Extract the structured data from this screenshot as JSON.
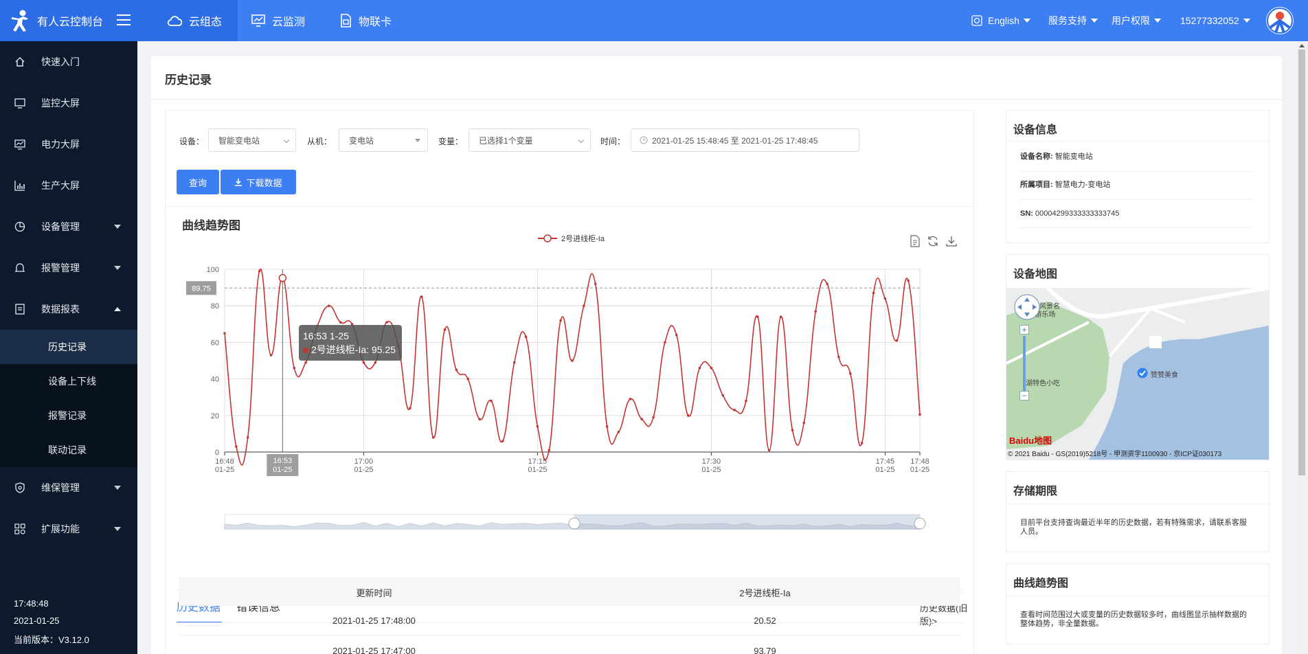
{
  "header": {
    "brand": "有人云控制台",
    "nav": [
      {
        "label": "云组态",
        "icon": "cloud-icon",
        "active": true
      },
      {
        "label": "云监测",
        "icon": "monitor-icon",
        "active": false
      },
      {
        "label": "物联卡",
        "icon": "sim-card-icon",
        "active": false
      }
    ],
    "language": "English",
    "service": "服务支持",
    "permissions": "用户权限",
    "account": "15277332052"
  },
  "sidebar": {
    "items": [
      {
        "label": "快速入门",
        "icon": "home-icon"
      },
      {
        "label": "监控大屏",
        "icon": "screen-icon"
      },
      {
        "label": "电力大屏",
        "icon": "power-screen-icon"
      },
      {
        "label": "生产大屏",
        "icon": "bar-chart-icon"
      },
      {
        "label": "设备管理",
        "icon": "device-icon"
      },
      {
        "label": "报警管理",
        "icon": "bell-icon"
      },
      {
        "label": "数据报表",
        "icon": "report-icon"
      }
    ],
    "sub_items": [
      {
        "label": "历史记录",
        "active": true
      },
      {
        "label": "设备上下线",
        "active": false
      },
      {
        "label": "报警记录",
        "active": false
      },
      {
        "label": "联动记录",
        "active": false
      }
    ],
    "bottom_items": [
      {
        "label": "维保管理",
        "icon": "shield-icon"
      },
      {
        "label": "扩展功能",
        "icon": "apps-icon"
      }
    ],
    "time": "17:48:48",
    "date": "2021-01-25",
    "version": "当前版本：V3.12.0"
  },
  "page": {
    "title": "历史记录"
  },
  "filters": {
    "device_label": "设备：",
    "device_value": "智能变电站",
    "slave_label": "从机：",
    "slave_value": "变电站",
    "variable_label": "变量：",
    "variable_value": "已选择1个变量",
    "time_label": "时间：",
    "time_value": "2021-01-25 15:48:45 至 2021-01-25 17:48:45",
    "query_button": "查询",
    "download_button": "下载数据"
  },
  "chart": {
    "title": "曲线趋势图",
    "legend": "2号进线柜-Ia",
    "markline_value": "89.75",
    "tooltip_title": "16:53 1-25",
    "tooltip_text": "2号进线柜-Ia: 95.25",
    "axis_pointer_label": "16:53",
    "axis_pointer_date": "01-25",
    "color": "#c23531"
  },
  "chart_data": {
    "type": "line",
    "title": "曲线趋势图",
    "xlabel": "",
    "ylabel": "",
    "ylim": [
      0,
      100
    ],
    "y_ticks": [
      "0",
      "20",
      "40",
      "60",
      "80",
      "100"
    ],
    "x_ticks": [
      {
        "time": "16:48",
        "date": "01-25"
      },
      {
        "time": "17:00",
        "date": "01-25"
      },
      {
        "time": "17:15",
        "date": "01-25"
      },
      {
        "time": "17:30",
        "date": "01-25"
      },
      {
        "time": "17:45",
        "date": "01-25"
      },
      {
        "time": "17:48",
        "date": "01-25"
      }
    ],
    "series": [
      {
        "name": "2号进线柜-Ia",
        "x": [
          "16:48",
          "16:49",
          "16:50",
          "16:51",
          "16:52",
          "16:53",
          "16:54",
          "16:55",
          "16:56",
          "16:57",
          "16:58",
          "16:59",
          "17:00",
          "17:01",
          "17:02",
          "17:03",
          "17:04",
          "17:05",
          "17:06",
          "17:07",
          "17:08",
          "17:09",
          "17:10",
          "17:11",
          "17:12",
          "17:13",
          "17:14",
          "17:15",
          "17:16",
          "17:17",
          "17:18",
          "17:19",
          "17:20",
          "17:21",
          "17:22",
          "17:23",
          "17:24",
          "17:25",
          "17:26",
          "17:27",
          "17:28",
          "17:29",
          "17:30",
          "17:31",
          "17:32",
          "17:33",
          "17:34",
          "17:35",
          "17:36",
          "17:37",
          "17:38",
          "17:39",
          "17:40",
          "17:41",
          "17:42",
          "17:43",
          "17:44",
          "17:45",
          "17:46",
          "17:47",
          "17:48"
        ],
        "values": [
          65,
          3,
          8,
          99,
          53,
          95.25,
          46,
          49,
          69,
          80,
          71,
          70,
          49,
          49,
          71,
          58,
          24,
          85,
          8,
          67,
          45,
          40,
          18,
          28,
          6,
          49,
          63,
          14,
          1,
          72,
          50,
          80,
          92,
          14,
          11,
          29,
          18,
          19,
          60,
          64,
          20,
          46,
          46,
          31,
          23,
          28,
          74,
          1,
          74,
          12,
          16,
          77,
          92,
          52,
          43,
          5,
          87,
          84,
          61,
          93.79,
          20.52
        ]
      }
    ],
    "markline": {
      "type": "average",
      "value": 89.75
    },
    "grid": true,
    "legend_position": "top-center"
  },
  "tabs": [
    {
      "label": "历史数据",
      "active": true
    },
    {
      "label": "错误信息",
      "active": false
    }
  ],
  "old_link": "历史数据(旧版)>",
  "table": {
    "headers": [
      "更新时间",
      "2号进线柜-Ia"
    ],
    "rows": [
      [
        "2021-01-25 17:48:00",
        "20.52"
      ],
      [
        "2021-01-25 17:47:00",
        "93.79"
      ]
    ]
  },
  "device_info": {
    "title": "设备信息",
    "name_label": "设备名称:",
    "name_value": "智能变电站",
    "project_label": "所属项目:",
    "project_value": "智慧电力-变电站",
    "sn_label": "SN:",
    "sn_value": "00004299333333333745"
  },
  "device_map": {
    "title": "设备地图",
    "poi1": "湖风景名",
    "poi1b": "-游乐场",
    "poi2": "湖特色小吃",
    "poi3": "赞赞美食",
    "logo": "Baidu地图",
    "copyright": "© 2021 Baidu - GS(2019)5218号 - 甲测资字1100930 - 京ICP证030173"
  },
  "storage": {
    "title": "存储期限",
    "text": "目前平台支持查询最近半年的历史数据，若有特殊需求，请联系客服人员。"
  },
  "trend_note": {
    "title": "曲线趋势图",
    "text": "查看时间范围过大或变量的历史数据较多时，曲线图显示抽样数据的整体趋势，非全量数据。"
  }
}
